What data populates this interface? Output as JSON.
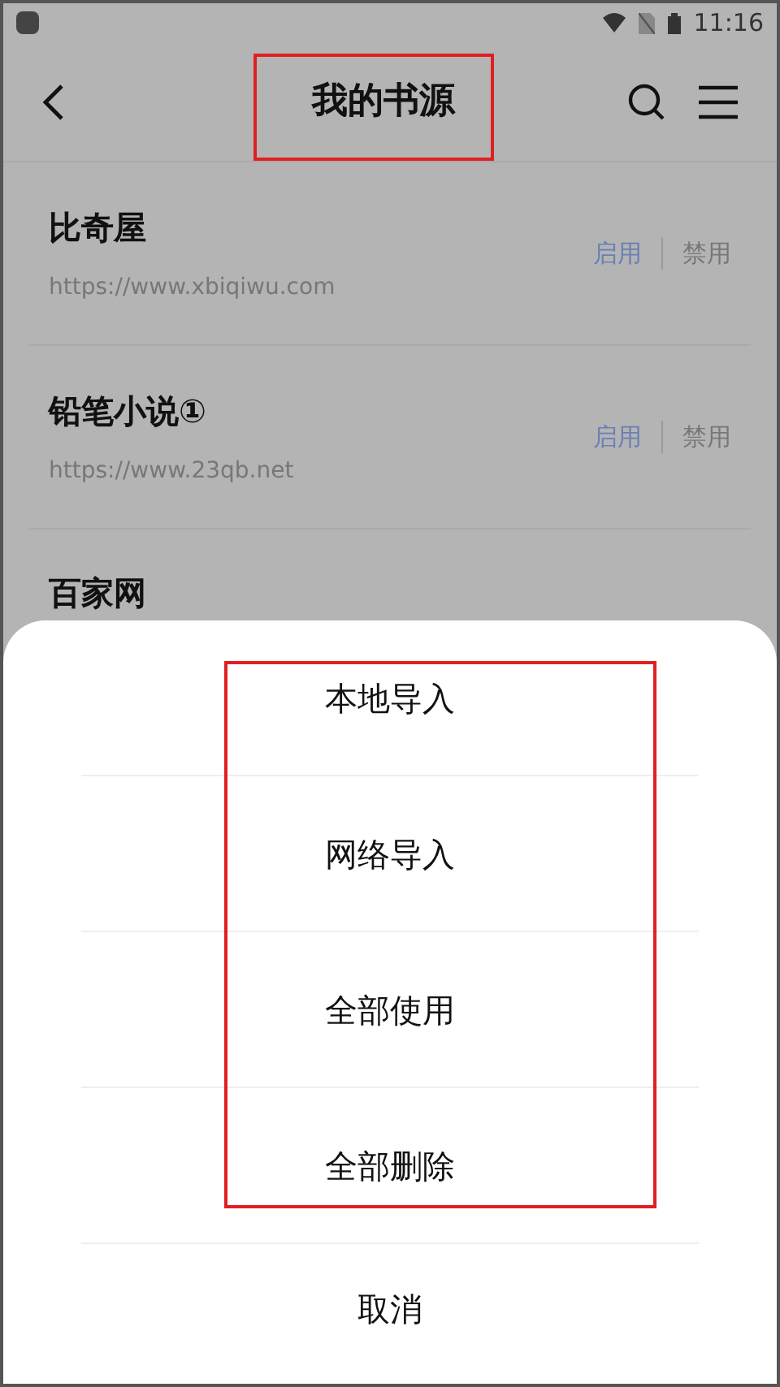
{
  "status_bar": {
    "time": "11:16"
  },
  "header": {
    "title": "我的书源"
  },
  "sources": [
    {
      "name": "比奇屋",
      "url": "https://www.xbiqiwu.com",
      "enable_label": "启用",
      "disable_label": "禁用",
      "enabled": true
    },
    {
      "name": "铅笔小说①",
      "url": "https://www.23qb.net",
      "enable_label": "启用",
      "disable_label": "禁用",
      "enabled": true
    },
    {
      "name": "百家网"
    }
  ],
  "sheet": {
    "options": [
      "本地导入",
      "网络导入",
      "全部使用",
      "全部删除"
    ],
    "cancel": "取消"
  }
}
